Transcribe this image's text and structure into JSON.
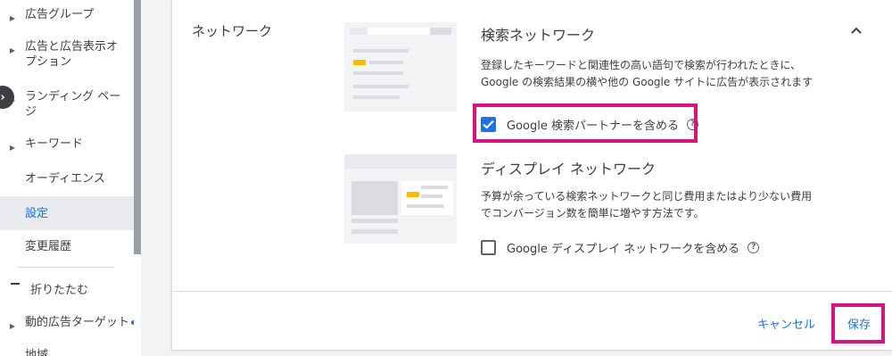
{
  "sidebar": {
    "items": [
      {
        "label": "広告グループ"
      },
      {
        "label": "広告と広告表示オプション"
      },
      {
        "label": "ランディング ページ"
      },
      {
        "label": "キーワード"
      },
      {
        "label": "オーディエンス"
      },
      {
        "label": "設定"
      },
      {
        "label": "変更履歴"
      },
      {
        "label": "折りたたむ"
      },
      {
        "label": "動的広告ターゲット"
      },
      {
        "label": "地域"
      }
    ]
  },
  "card": {
    "section_title": "ネットワーク",
    "search_network": {
      "title": "検索ネットワーク",
      "description": "登録したキーワードと関連性の高い語句で検索が行われたときに、Google の検索結果の横や他の Google サイトに広告が表示されます",
      "checkbox_label": "Google 検索パートナーを含める",
      "checked": true
    },
    "display_network": {
      "title": "ディスプレイ ネットワーク",
      "description": "予算が余っている検索ネットワークと同じ費用またはより少ない費用でコンバージョン数を簡単に増やす方法です。",
      "checkbox_label": "Google ディスプレイ ネットワークを含める",
      "checked": false
    },
    "cancel_label": "キャンセル",
    "save_label": "保存"
  },
  "colors": {
    "accent": "#1a73e8",
    "highlight": "#d6147f",
    "ad_yellow": "#fbbc04"
  }
}
